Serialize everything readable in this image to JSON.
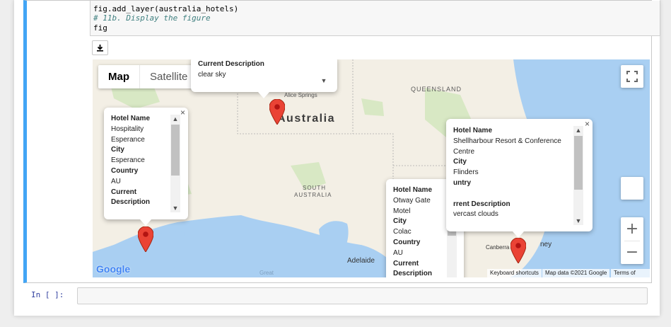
{
  "code": {
    "lines": [
      "fig.add_layer(australia_hotels)",
      "# 11b. Display the figure",
      "fig"
    ]
  },
  "download_icon": "download-icon",
  "map": {
    "type_buttons": [
      "Map",
      "Satellite"
    ],
    "labels": {
      "country": "Australia",
      "queensland": "QUEENSLAND",
      "south_australia_1": "SOUTH",
      "south_australia_2": "AUSTRALIA",
      "alice_springs": "Alice Springs",
      "adelaide": "Adelaide",
      "canberra": "Canberra",
      "sydney_partial": "ney",
      "great": "Great"
    },
    "footer": {
      "keyboard": "Keyboard shortcuts",
      "map_data": "Map data ©2021 Google",
      "terms": "Terms of Use"
    },
    "google_logo": "Google",
    "zoom_in": "+",
    "zoom_out": "−",
    "fullscreen_icon": "fullscreen-icon",
    "colors": {
      "water": "#a9cff2",
      "land": "#f3efe5",
      "pin": "#ea4335"
    }
  },
  "infowindows": {
    "alice": {
      "partial_label": "Current Description",
      "partial_value": "clear sky"
    },
    "esperance": {
      "rows": [
        {
          "k": "Hotel Name",
          "bold": true
        },
        {
          "k": "Hospitality",
          "bold": false
        },
        {
          "k": "Esperance",
          "bold": false
        },
        {
          "k": "City",
          "bold": true
        },
        {
          "k": "Esperance",
          "bold": false
        },
        {
          "k": "Country",
          "bold": true
        },
        {
          "k": "AU",
          "bold": false
        },
        {
          "k": "Current",
          "bold": true
        },
        {
          "k": "Description",
          "bold": true
        }
      ]
    },
    "otway": {
      "rows": [
        {
          "k": "Hotel Name",
          "bold": true
        },
        {
          "k": "Otway Gate",
          "bold": false
        },
        {
          "k": "Motel",
          "bold": false
        },
        {
          "k": "City",
          "bold": true
        },
        {
          "k": "Colac",
          "bold": false
        },
        {
          "k": "Country",
          "bold": true
        },
        {
          "k": "AU",
          "bold": false
        },
        {
          "k": "Current",
          "bold": true
        },
        {
          "k": "Description",
          "bold": true
        }
      ]
    },
    "shellharbour": {
      "rows": [
        {
          "k": "Hotel Name",
          "bold": true
        },
        {
          "k": "Shellharbour Resort & Conference",
          "bold": false
        },
        {
          "k": "Centre",
          "bold": false
        },
        {
          "k": "City",
          "bold": true
        },
        {
          "k": "Flinders",
          "bold": false
        },
        {
          "k": "untry",
          "bold": true
        },
        {
          "k": "",
          "bold": false
        },
        {
          "k": "rrent Description",
          "bold": true
        },
        {
          "k": "vercast clouds",
          "bold": false
        }
      ]
    },
    "close_symbol": "×"
  },
  "next_cell": {
    "prompt": "In [ ]:"
  }
}
